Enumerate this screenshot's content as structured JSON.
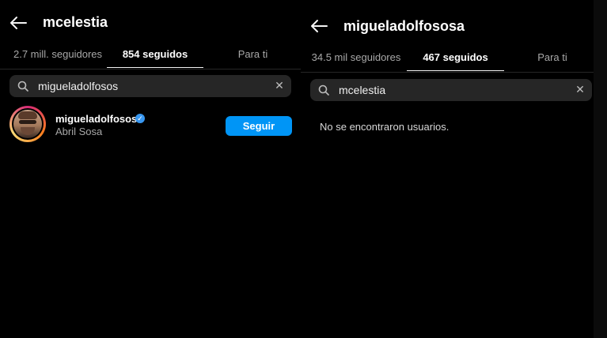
{
  "left": {
    "title": "mcelestia",
    "tabs": [
      {
        "label": "2.7 mill. seguidores",
        "active": false
      },
      {
        "label": "854 seguidos",
        "active": true
      },
      {
        "label": "Para ti",
        "active": false
      }
    ],
    "search": {
      "value": "migueladolfosos"
    },
    "results": [
      {
        "username": "migueladolfososa",
        "full_name": "Abril Sosa",
        "verified": true,
        "action": "Seguir"
      }
    ]
  },
  "right": {
    "title": "migueladolfososa",
    "tabs": [
      {
        "label": "34.5 mil seguidores",
        "active": false
      },
      {
        "label": "467 seguidos",
        "active": true
      },
      {
        "label": "Para ti",
        "active": false
      }
    ],
    "search": {
      "value": "mcelestia"
    },
    "empty_message": "No se encontraron usuarios."
  },
  "colors": {
    "accent": "#0095f6",
    "verified": "#3897f0",
    "search_bg": "#262626",
    "muted_text": "#a8a8a8"
  },
  "icons": {
    "back": "arrow-left-icon",
    "search": "search-icon",
    "clear": "close-icon",
    "verified": "verified-badge-icon"
  }
}
